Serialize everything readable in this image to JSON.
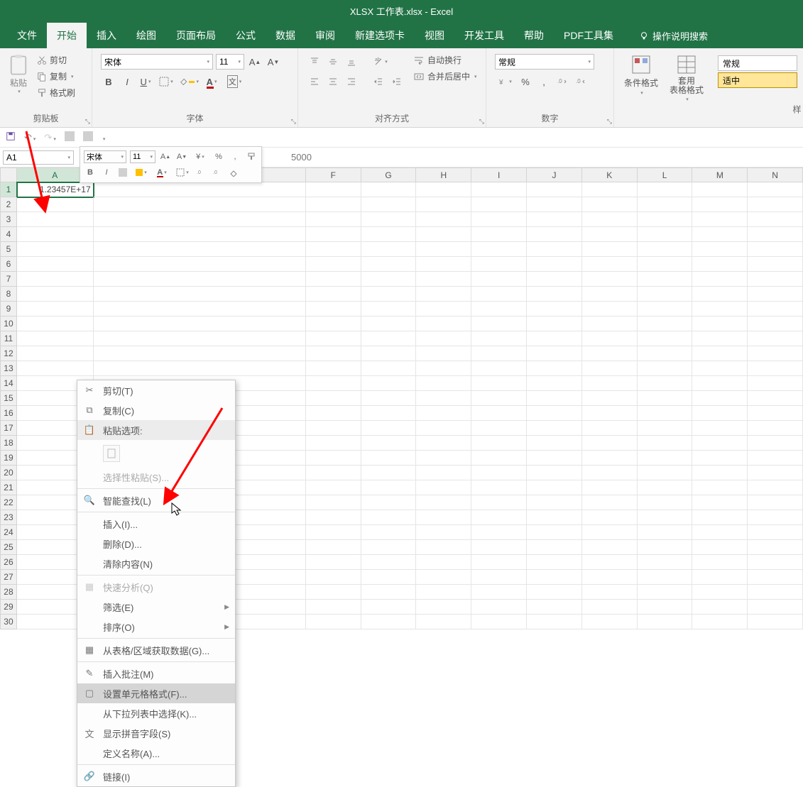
{
  "title": "XLSX 工作表.xlsx  -  Excel",
  "tabs": [
    "文件",
    "开始",
    "插入",
    "绘图",
    "页面布局",
    "公式",
    "数据",
    "审阅",
    "新建选项卡",
    "视图",
    "开发工具",
    "帮助",
    "PDF工具集"
  ],
  "active_tab_index": 1,
  "tell_me": "操作说明搜索",
  "ribbon": {
    "clipboard": {
      "paste": "粘贴",
      "cut": "剪切",
      "copy": "复制",
      "format_painter": "格式刷",
      "label": "剪贴板"
    },
    "font": {
      "name": "宋体",
      "size": "11",
      "label": "字体"
    },
    "align": {
      "wrap": "自动换行",
      "merge": "合并后居中",
      "label": "对齐方式"
    },
    "number": {
      "format": "常规",
      "label": "数字"
    },
    "styles": {
      "conditional": "条件格式",
      "as_table": "套用\n表格格式",
      "gallery_normal": "常规",
      "gallery_good": "适中"
    },
    "right_edge": "样"
  },
  "namebox": "A1",
  "formula_partial": "5000",
  "mini": {
    "font": "宋体",
    "size": "11"
  },
  "columns": [
    "A",
    "F",
    "G",
    "H",
    "I",
    "J",
    "K",
    "L",
    "M",
    "N"
  ],
  "col_widths": {
    "A": 108,
    "spacer": 300,
    "default": 78
  },
  "rows": 30,
  "cell_A1": "1.23457E+17",
  "context_menu": {
    "cut": "剪切(T)",
    "copy": "复制(C)",
    "paste_options": "粘贴选项:",
    "paste_special": "选择性粘贴(S)...",
    "smart_lookup": "智能查找(L)",
    "insert": "插入(I)...",
    "delete": "删除(D)...",
    "clear": "清除内容(N)",
    "quick_analysis": "快速分析(Q)",
    "filter": "筛选(E)",
    "sort": "排序(O)",
    "get_data": "从表格/区域获取数据(G)...",
    "insert_comment": "插入批注(M)",
    "format_cells": "设置单元格格式(F)...",
    "dropdown_pick": "从下拉列表中选择(K)...",
    "phonetic": "显示拼音字段(S)",
    "define_name": "定义名称(A)...",
    "hyperlink": "链接(I)"
  }
}
